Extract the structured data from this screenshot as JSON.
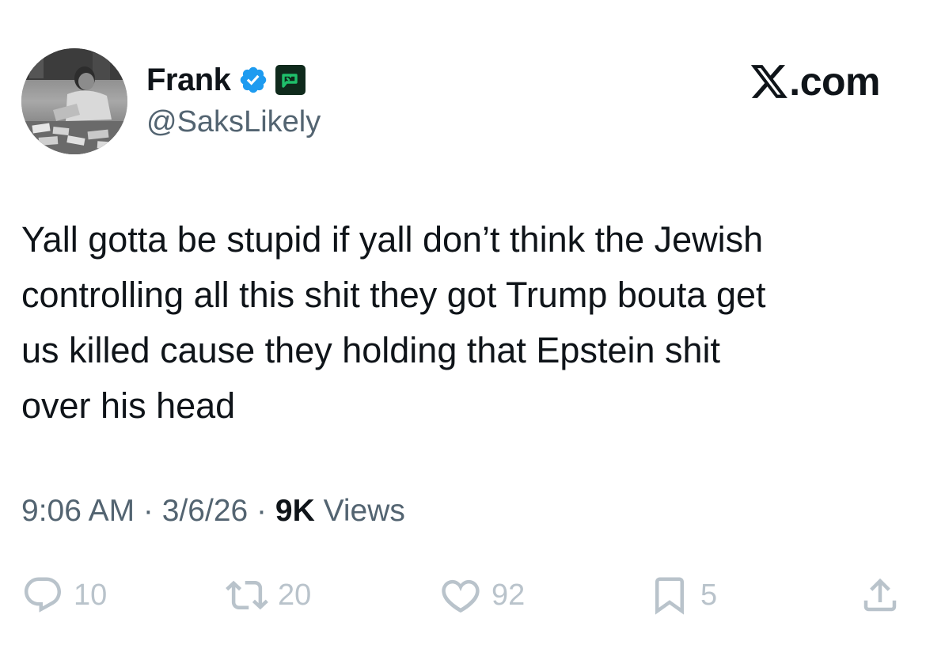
{
  "author": {
    "name": "Frank",
    "handle": "@SaksLikely",
    "avatar_icon": "profile-photo",
    "verified_icon": "verified-badge-icon",
    "affiliate_icon": "green-badge-icon"
  },
  "site": {
    "logo_icon": "x-logo-icon",
    "name": ".com"
  },
  "tweet": {
    "text": "Yall gotta be stupid if yall don’t think the Jewish\ncontrolling all this shit they got Trump bouta get\nus killed cause they holding that Epstein shit\nover his head"
  },
  "meta": {
    "time": "9:06 AM",
    "separator": " · ",
    "date": "3/6/26",
    "views_count": "9K",
    "views_label": " Views"
  },
  "actions": {
    "replies": "10",
    "reposts": "20",
    "likes": "92",
    "bookmarks": "5"
  },
  "colors": {
    "text": "#0f1419",
    "secondary": "#536471",
    "action_gray": "#b9c3cb",
    "verified_blue": "#1d9bf0",
    "badge_green": "#1fbf6a"
  }
}
